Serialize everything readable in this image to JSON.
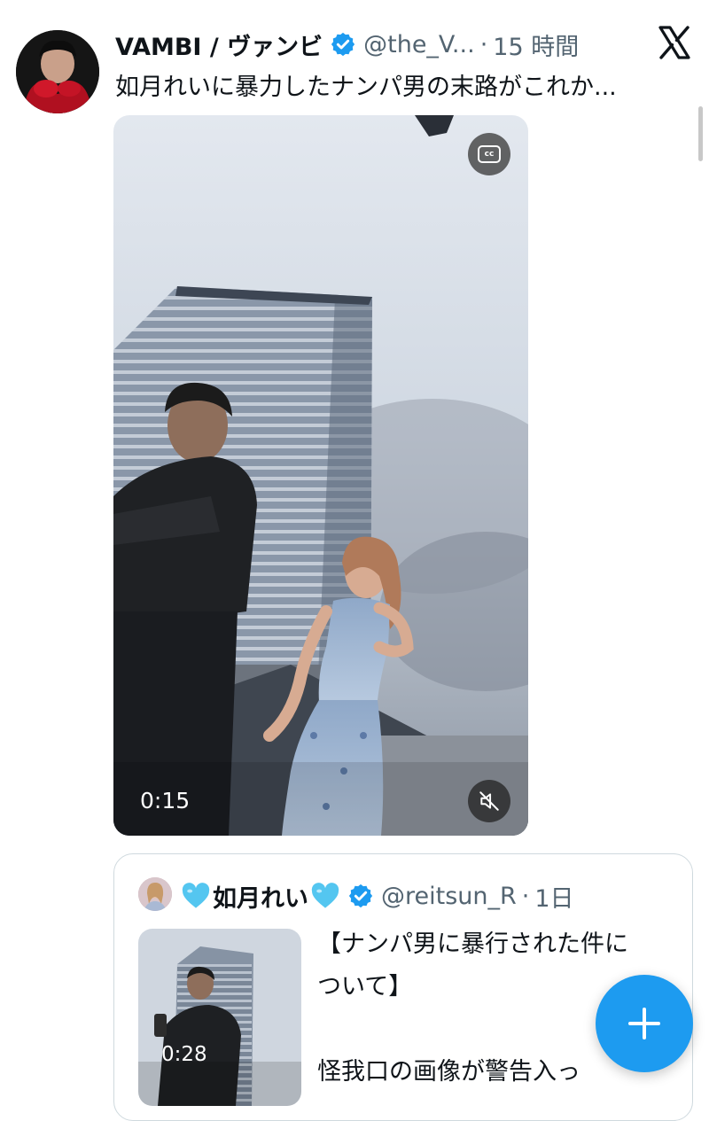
{
  "tweet": {
    "author_name": "VAMBI / ヴァンビ",
    "handle": "@the_V...",
    "separator": "·",
    "time": "15 時間",
    "text": "如月れいに暴力したナンパ男の末路がこれか...",
    "video": {
      "duration": "0:15"
    }
  },
  "quoted_tweet": {
    "author_name": "如月れい",
    "handle": "@reitsun_R",
    "separator": "·",
    "time": "1日",
    "video_duration": "0:28",
    "text_lines": [
      "【ナンパ男に暴行された件に",
      "ついて】",
      "",
      "怪我口の画像が警告入っ"
    ]
  },
  "icons": {
    "verified": "verified-badge-icon",
    "close": "x-logo-icon",
    "captions": "closed-captions-icon",
    "mute": "speaker-muted-icon",
    "heart": "light-blue-heart-icon",
    "compose": "plus-icon"
  },
  "colors": {
    "accent": "#1d9bf0",
    "secondary_text": "#536471",
    "heart": "#54c6f0"
  }
}
